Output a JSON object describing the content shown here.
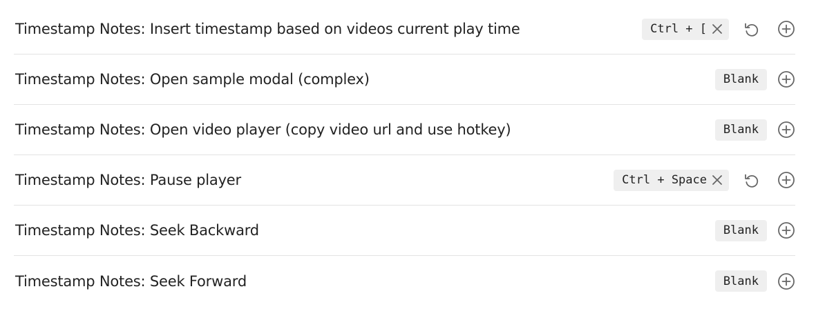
{
  "hotkeys": [
    {
      "label": "Timestamp Notes: Insert timestamp based on videos current play time",
      "hotkey": "Ctrl + [",
      "assigned": true
    },
    {
      "label": "Timestamp Notes: Open sample modal (complex)",
      "hotkey": "Blank",
      "assigned": false
    },
    {
      "label": "Timestamp Notes: Open video player (copy video url and use hotkey)",
      "hotkey": "Blank",
      "assigned": false
    },
    {
      "label": "Timestamp Notes: Pause player",
      "hotkey": "Ctrl + Space",
      "assigned": true
    },
    {
      "label": "Timestamp Notes: Seek Backward",
      "hotkey": "Blank",
      "assigned": false
    },
    {
      "label": "Timestamp Notes: Seek Forward",
      "hotkey": "Blank",
      "assigned": false
    }
  ],
  "icons": {
    "remove": "close-icon",
    "restore": "restore-default-icon",
    "add": "plus-circle-icon"
  },
  "colors": {
    "text": "#222222",
    "icon": "#666666",
    "chip_bg": "#efefef",
    "divider": "#e3e3e3"
  }
}
